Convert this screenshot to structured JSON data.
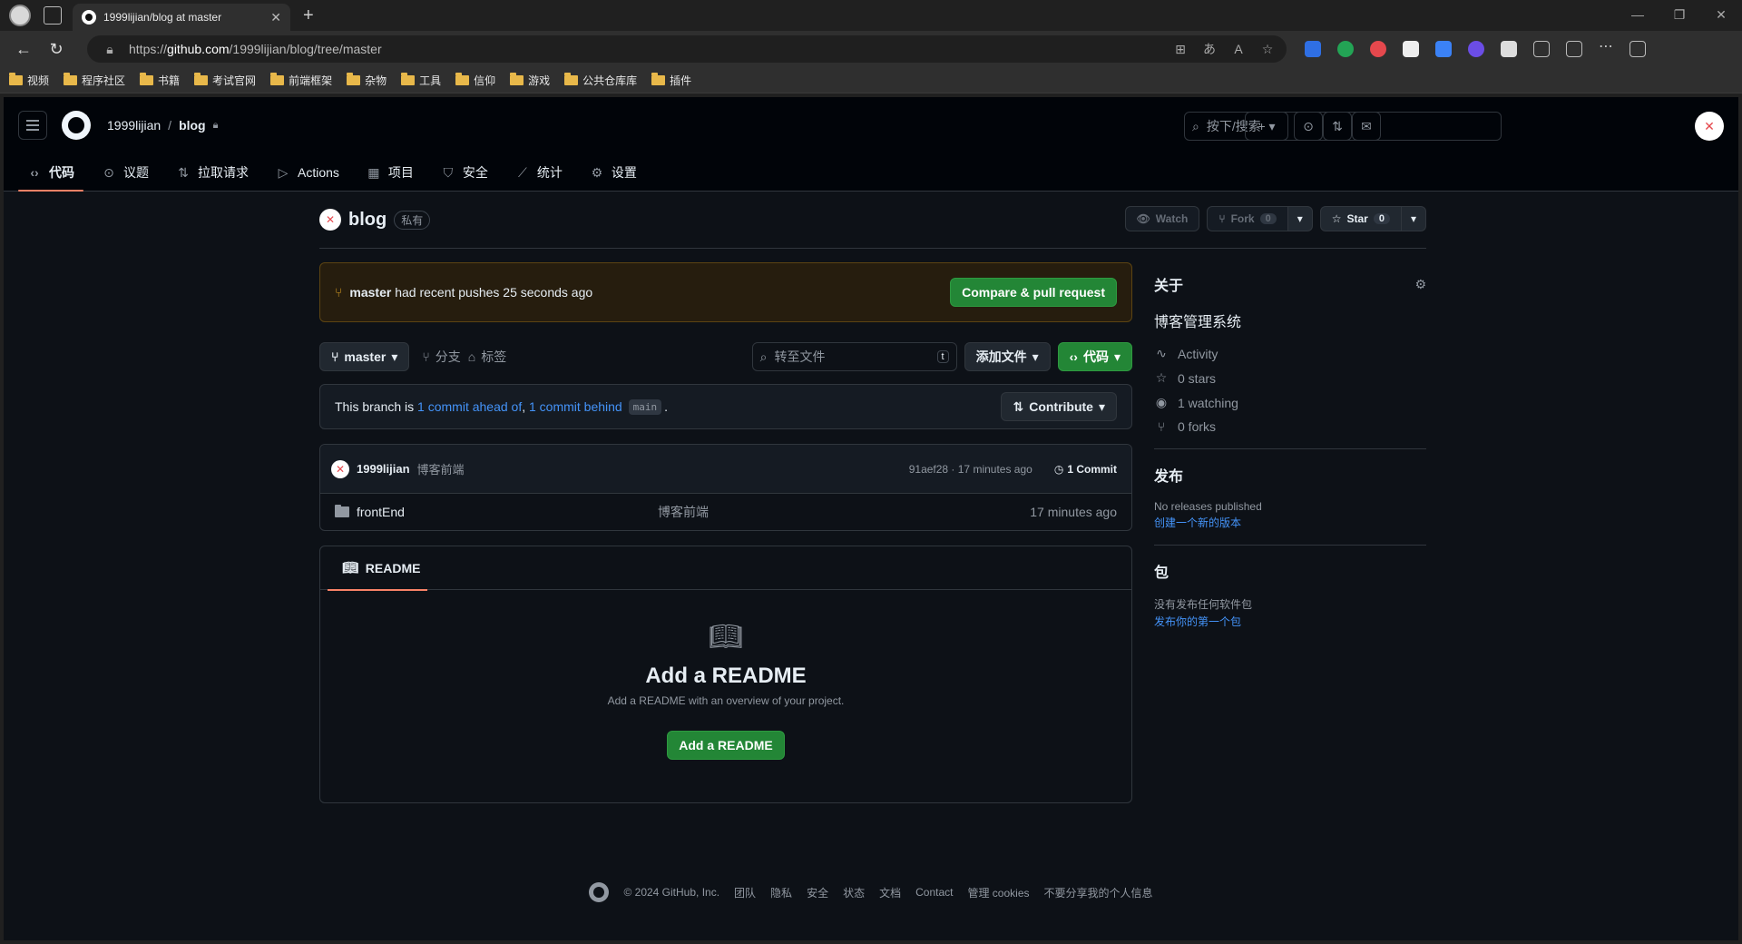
{
  "browser": {
    "tab_title": "1999lijian/blog at master",
    "url_host": "github.com",
    "url_prefix": "https://",
    "url_path": "/1999lijian/blog/tree/master",
    "bookmarks": [
      "视频",
      "程序社区",
      "书籍",
      "考试官网",
      "前端框架",
      "杂物",
      "工具",
      "信仰",
      "游戏",
      "公共仓库库",
      "插件"
    ]
  },
  "header": {
    "owner": "1999lijian",
    "separator": "/",
    "repo": "blog",
    "search_placeholder": "按下/搜索",
    "nav": [
      {
        "label": "代码",
        "icon": "code-icon"
      },
      {
        "label": "议题",
        "icon": "issue-icon"
      },
      {
        "label": "拉取请求",
        "icon": "pull-request-icon"
      },
      {
        "label": "Actions",
        "icon": "play-icon"
      },
      {
        "label": "项目",
        "icon": "table-icon"
      },
      {
        "label": "安全",
        "icon": "shield-icon"
      },
      {
        "label": "统计",
        "icon": "graph-icon"
      },
      {
        "label": "设置",
        "icon": "gear-icon"
      }
    ]
  },
  "repo": {
    "name": "blog",
    "visibility": "私有",
    "watch_label": "Watch",
    "fork_label": "Fork",
    "fork_count": "0",
    "star_label": "Star",
    "star_count": "0"
  },
  "banner": {
    "branch": "master",
    "message": "had recent pushes 25 seconds ago",
    "button": "Compare & pull request"
  },
  "filebar": {
    "branch": "master",
    "branches_label": "分支",
    "tags_label": "标签",
    "goto_placeholder": "转至文件",
    "goto_key": "t",
    "add_file": "添加文件",
    "code_button": "代码"
  },
  "branch_status": {
    "prefix": "This branch is",
    "ahead": "1 commit ahead of",
    "comma": ",",
    "behind": "1 commit behind",
    "base": "main",
    "suffix": ".",
    "contribute": "Contribute"
  },
  "commit": {
    "author": "1999lijian",
    "message": "博客前端",
    "meta": "91aef28 · 17 minutes ago",
    "count": "1 Commit"
  },
  "files": [
    {
      "name": "frontEnd",
      "message": "博客前端",
      "time": "17 minutes ago"
    }
  ],
  "readme": {
    "tab": "README",
    "title": "Add a README",
    "subtitle": "Add a README with an overview of your project.",
    "button": "Add a README"
  },
  "sidebar": {
    "about_title": "关于",
    "description": "博客管理系统",
    "stats": [
      {
        "icon": "pulse-icon",
        "label": "Activity"
      },
      {
        "icon": "star-icon",
        "label": "0 stars"
      },
      {
        "icon": "eye-icon",
        "label": "1 watching"
      },
      {
        "icon": "fork-icon",
        "label": "0 forks"
      }
    ],
    "releases_title": "发布",
    "releases_text": "No releases published",
    "releases_link": "创建一个新的版本",
    "packages_title": "包",
    "packages_text": "没有发布任何软件包",
    "packages_link": "发布你的第一个包"
  },
  "footer": {
    "copyright": "© 2024 GitHub, Inc.",
    "links": [
      "团队",
      "隐私",
      "安全",
      "状态",
      "文档",
      "Contact",
      "管理 cookies",
      "不要分享我的个人信息"
    ]
  }
}
